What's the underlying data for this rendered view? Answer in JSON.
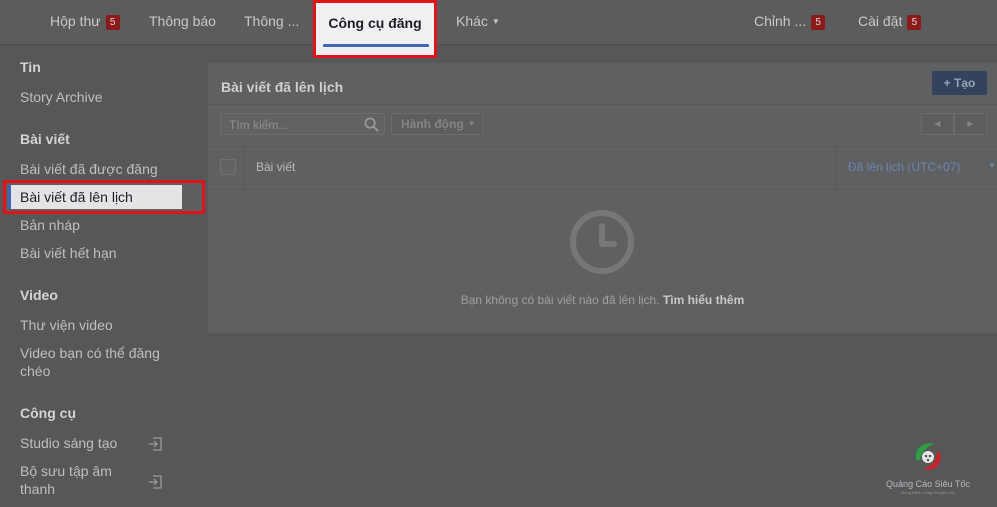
{
  "topnav": {
    "inbox": {
      "label": "Hộp thư",
      "badge": "5"
    },
    "notifications": "Thông báo",
    "insights": "Thông ...",
    "publishing_tools": "Công cụ đăng",
    "more": "Khác",
    "edit": {
      "label": "Chỉnh ...",
      "badge": "5"
    },
    "settings": {
      "label": "Cài đặt",
      "badge": "5"
    }
  },
  "sidebar": {
    "sections": [
      {
        "title": "Tin",
        "items": [
          "Story Archive"
        ]
      },
      {
        "title": "Bài viết",
        "items": [
          "Bài viết đã được đăng",
          "Bài viết đã lên lịch",
          "Bản nháp",
          "Bài viết hết hạn"
        ]
      },
      {
        "title": "Video",
        "items": [
          "Thư viện video",
          "Video bạn có thể đăng chéo"
        ]
      },
      {
        "title": "Công cụ",
        "items": [
          "Studio sáng tạo",
          "Bộ sưu tập âm thanh"
        ]
      }
    ],
    "active_item": "Bài viết đã lên lịch"
  },
  "main": {
    "title": "Bài viết đã lên lịch",
    "create_label": "+ Tạo",
    "search_placeholder": "Tìm kiếm...",
    "actions_label": "Hành động",
    "pager_prev": "◀",
    "pager_next": "▶",
    "col_post": "Bài viết",
    "col_scheduled": "Đã lên lịch (UTC+07)",
    "empty_text": "Bạn không có bài viết nào đã lên lịch.",
    "learn_more": "Tìm hiểu thêm"
  },
  "logo": {
    "name": "Quảng Cáo Siêu Tốc",
    "tagline": "Đồng Hành Cùng Chuyên Gia"
  },
  "colors": {
    "highlight_border": "#e0121a",
    "accent": "#4267b2",
    "badge": "#8b1a1a"
  }
}
